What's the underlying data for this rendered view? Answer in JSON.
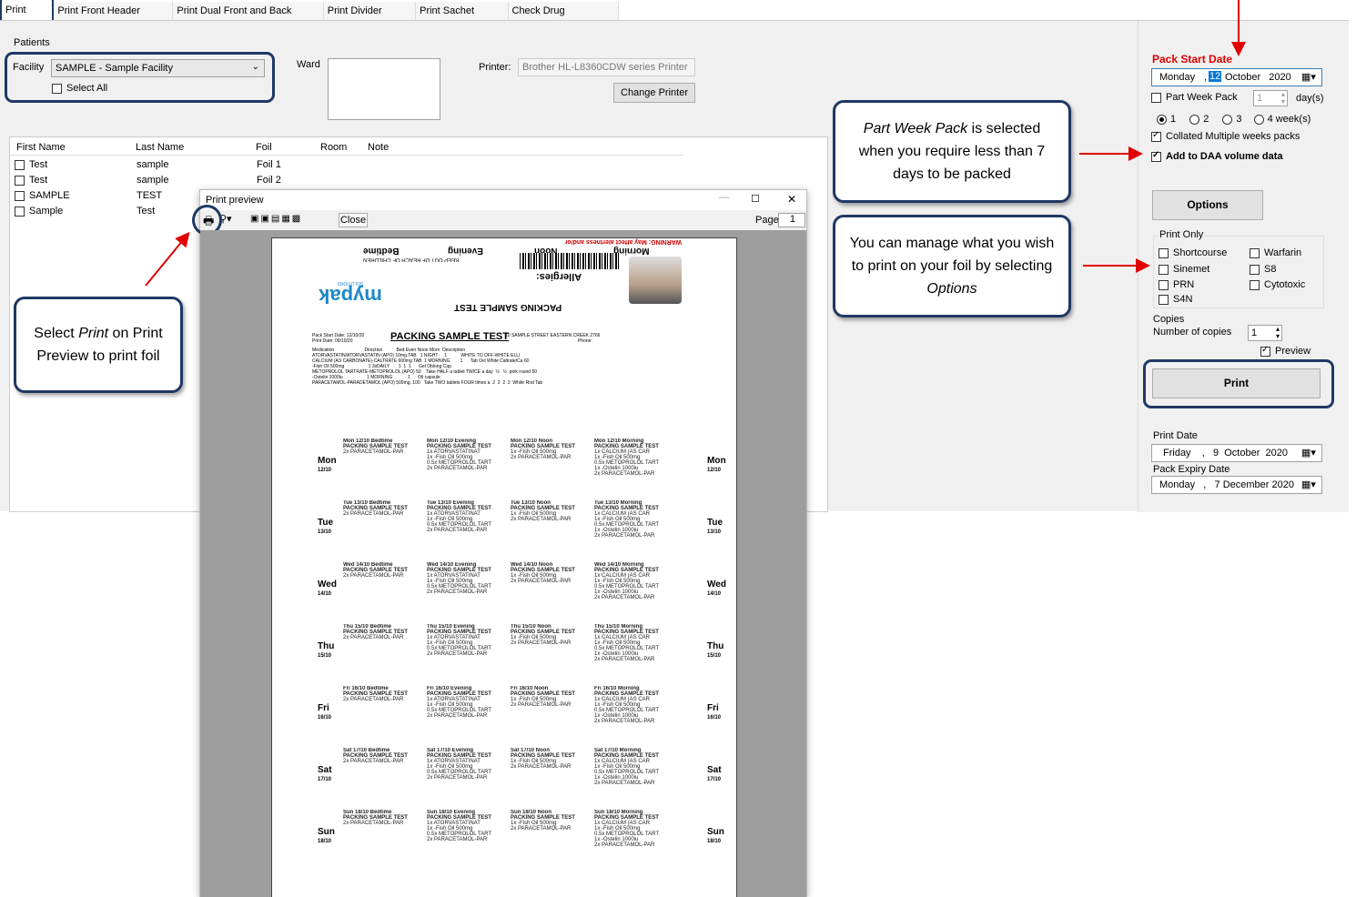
{
  "tabs": [
    "Print Foils",
    "Print Front Header Labels",
    "Print Dual Front and Back Labels",
    "Print Divider Labels",
    "Print Sachet Labels",
    "Check Drug Description"
  ],
  "patients": {
    "group": "Patients",
    "facility_label": "Facility",
    "facility_value": "SAMPLE - Sample Facility",
    "select_all": "Select All",
    "ward_label": "Ward"
  },
  "printer": {
    "label": "Printer:",
    "value": "Brother HL-L8360CDW series Printer",
    "change_btn": "Change Printer"
  },
  "grid": {
    "headers": [
      "First Name",
      "Last Name",
      "Foil",
      "Room",
      "Note"
    ],
    "rows": [
      [
        "Test",
        "sample",
        "Foil 1"
      ],
      [
        "Test",
        "sample",
        "Foil 2"
      ],
      [
        "SAMPLE",
        "TEST",
        ""
      ],
      [
        "Sample",
        "Test",
        ""
      ]
    ]
  },
  "preview": {
    "title": "Print preview",
    "close": "Close",
    "page_label": "Page",
    "page_value": "1",
    "win_min": "—",
    "win_max": "☐",
    "win_close": "✕"
  },
  "doc": {
    "header_top": "WARNING: May affect alertness and/or co-ordination",
    "header_times": [
      "Bedtime",
      "Evening",
      "Noon",
      "Morning"
    ],
    "keep_out": "KEEP OUT OF REACH OF CHILDREN",
    "allergies": "Allergies:",
    "logo": "mypak",
    "logo_sub": "SOLUTIONS",
    "pack_title": "PACKING SAMPLE TEST",
    "pack_start": "Pack Start Date: 12/10/20",
    "print_date": "Print Date: 09/10/20",
    "address": "10 SAMPLE STREET EASTERN CREEK 2766",
    "phone": "Phone:",
    "med_rows": [
      "Medication                        Direction           Bed Even Noon Morn  Description",
      "ATORVASTATIN/ATORVASTATIN (APO) 10mg TAB   1 NIGHT     1           WHITE TO OFF-WHITE ELLI",
      "CALCIUM (AS CARBONATE)-CALTRATE 600mg TAB  1 MORNING        1      Tab Ovl White Caltrate/Ca 60",
      "-Fish Oil 500mg                   1 3xDAILY       1  1  1      Gel Oblong Cap",
      "METOPROLOL TARTRATE-METOPROLOL (APO) 50    Take HALF a tablet TWICE a day  ½   ½  pink round 50",
      "-Ostelin 1000iu                   1 MORNING            1      Oil capsule",
      "PARACETAMOL-PARADETAMOL (APO) 500mg, 100   Take TWO tablets FOUR times a  2  2  2  2  White Rnd Tab"
    ],
    "days": [
      {
        "day": "Mon",
        "date": "12/10"
      },
      {
        "day": "Tue",
        "date": "13/10"
      },
      {
        "day": "Wed",
        "date": "14/10"
      },
      {
        "day": "Thu",
        "date": "15/10"
      },
      {
        "day": "Fri",
        "date": "16/10"
      },
      {
        "day": "Sat",
        "date": "17/10"
      },
      {
        "day": "Sun",
        "date": "18/10"
      }
    ],
    "slots": [
      "Bedtime",
      "Evening",
      "Noon",
      "Morning"
    ],
    "slot_name": "PACKING SAMPLE TEST",
    "slot_meds": {
      "Bedtime": [
        "2x PARACETAMOL-PAR"
      ],
      "Evening": [
        "1x ATORVASTATINAT",
        "1x -Fish Oil 500mg",
        "0.5x METOPROLOL TART",
        "2x PARACETAMOL-PAR"
      ],
      "Noon": [
        "1x -Fish Oil 500mg",
        "2x PARACETAMOL-PAR"
      ],
      "Morning": [
        "1x CALCIUM (AS CAR",
        "1x -Fish Oil 500mg",
        "0.5x METOPROLOL TART",
        "1x -Ostelin 1000iu",
        "2x PARACETAMOL-PAR"
      ]
    }
  },
  "right": {
    "pack_start_label": "Pack Start Date",
    "pack_start_weekday": "Monday",
    "pack_start_day": "12",
    "pack_start_rest": "October   2020",
    "part_week": "Part Week Pack",
    "part_week_value": "1",
    "days_label": "day(s)",
    "weeks": [
      "1",
      "2",
      "3",
      "4 week(s)"
    ],
    "collated": "Collated Multiple weeks packs",
    "daa": "Add to DAA volume data",
    "options_btn": "Options",
    "print_only": "Print Only",
    "print_only_items": [
      "Shortcourse",
      "Warfarin",
      "Sinemet",
      "S8",
      "PRN",
      "Cytotoxic",
      "S4N"
    ],
    "copies": "Copies",
    "num_copies": "Number of copies",
    "copies_value": "1",
    "preview": "Preview",
    "print_btn": "Print",
    "print_date_label": "Print Date",
    "print_date_value": "Friday    ,   9  October  2020",
    "expiry_label": "Pack Expiry Date",
    "expiry_value": "Monday   ,   7 December 2020"
  },
  "callouts": {
    "c1_em": "Part Week Pack",
    "c1_rest": " is selected when you require less than 7 days to be packed",
    "c2_a": "You can manage what you wish to print on your foil by selecting ",
    "c2_em": "Options",
    "c3_a": "Select ",
    "c3_em": "Print",
    "c3_b": " on Print Preview to print foil"
  },
  "colors": {
    "highlight": "#1f3864",
    "arrow": "#e00000",
    "red_label": "#e00000"
  }
}
